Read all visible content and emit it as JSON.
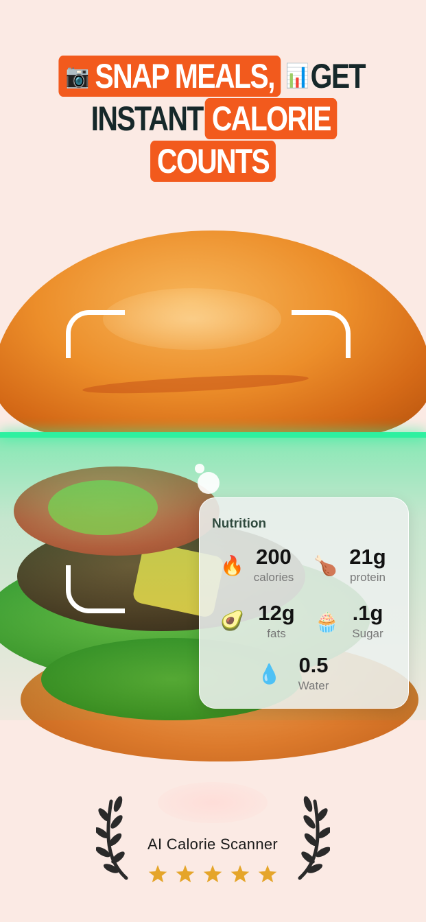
{
  "headline": {
    "line1_emoji_left": "📷",
    "line1_box": "SNAP MEALS,",
    "line1_emoji_mid": "📊",
    "line1_dark": "GET",
    "line2_dark": "INSTANT",
    "line2_box": "CALORIE",
    "line3_box": "COUNTS"
  },
  "nutrition": {
    "title": "Nutrition",
    "items": [
      {
        "emoji": "🔥",
        "value": "200",
        "label": "calories",
        "icon": "fire-icon"
      },
      {
        "emoji": "🍗",
        "value": "21g",
        "label": "protein",
        "icon": "drumstick-icon"
      },
      {
        "emoji": "🥑",
        "value": "12g",
        "label": "fats",
        "icon": "avocado-icon"
      },
      {
        "emoji": "🧁",
        "value": ".1g",
        "label": "Sugar",
        "icon": "cupcake-icon"
      },
      {
        "emoji": "💧",
        "value": "0.5",
        "label": "Water",
        "icon": "water-drop-icon"
      }
    ]
  },
  "badge": {
    "text": "AI Calorie Scanner",
    "rating": 5,
    "star_color": "#e5a52a"
  },
  "colors": {
    "background": "#fbeae4",
    "accent": "#f25a1d",
    "scan": "#2ef0a0"
  }
}
